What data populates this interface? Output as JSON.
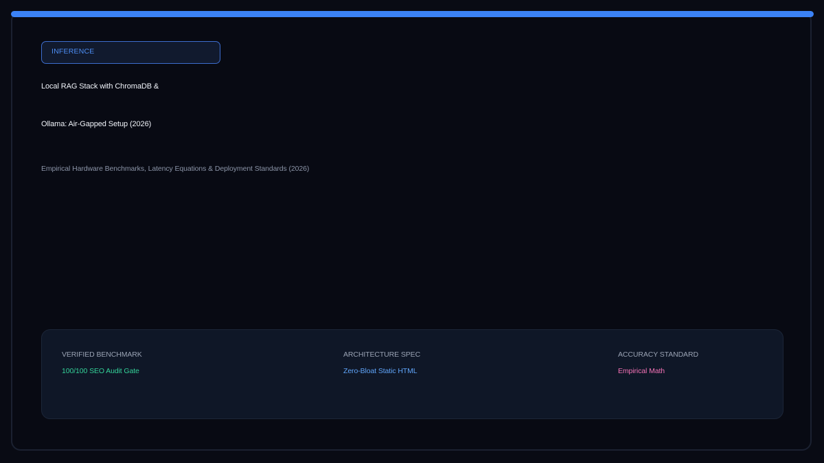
{
  "header": {
    "accent_color": "#3b82f6"
  },
  "badge": {
    "label": "INFERENCE"
  },
  "title": {
    "line1": "Local RAG Stack with ChromaDB &",
    "line2": "Ollama: Air-Gapped Setup (2026)"
  },
  "subtitle": "Empirical Hardware Benchmarks, Latency Equations & Deployment Standards (2026)",
  "stats": [
    {
      "label": "VERIFIED BENCHMARK",
      "value": "100/100 SEO Audit Gate",
      "color": "#34d399"
    },
    {
      "label": "ARCHITECTURE SPEC",
      "value": "Zero-Bloat Static HTML",
      "color": "#60a5fa"
    },
    {
      "label": "ACCURACY STANDARD",
      "value": "Empirical Math",
      "color": "#f472b6"
    }
  ]
}
